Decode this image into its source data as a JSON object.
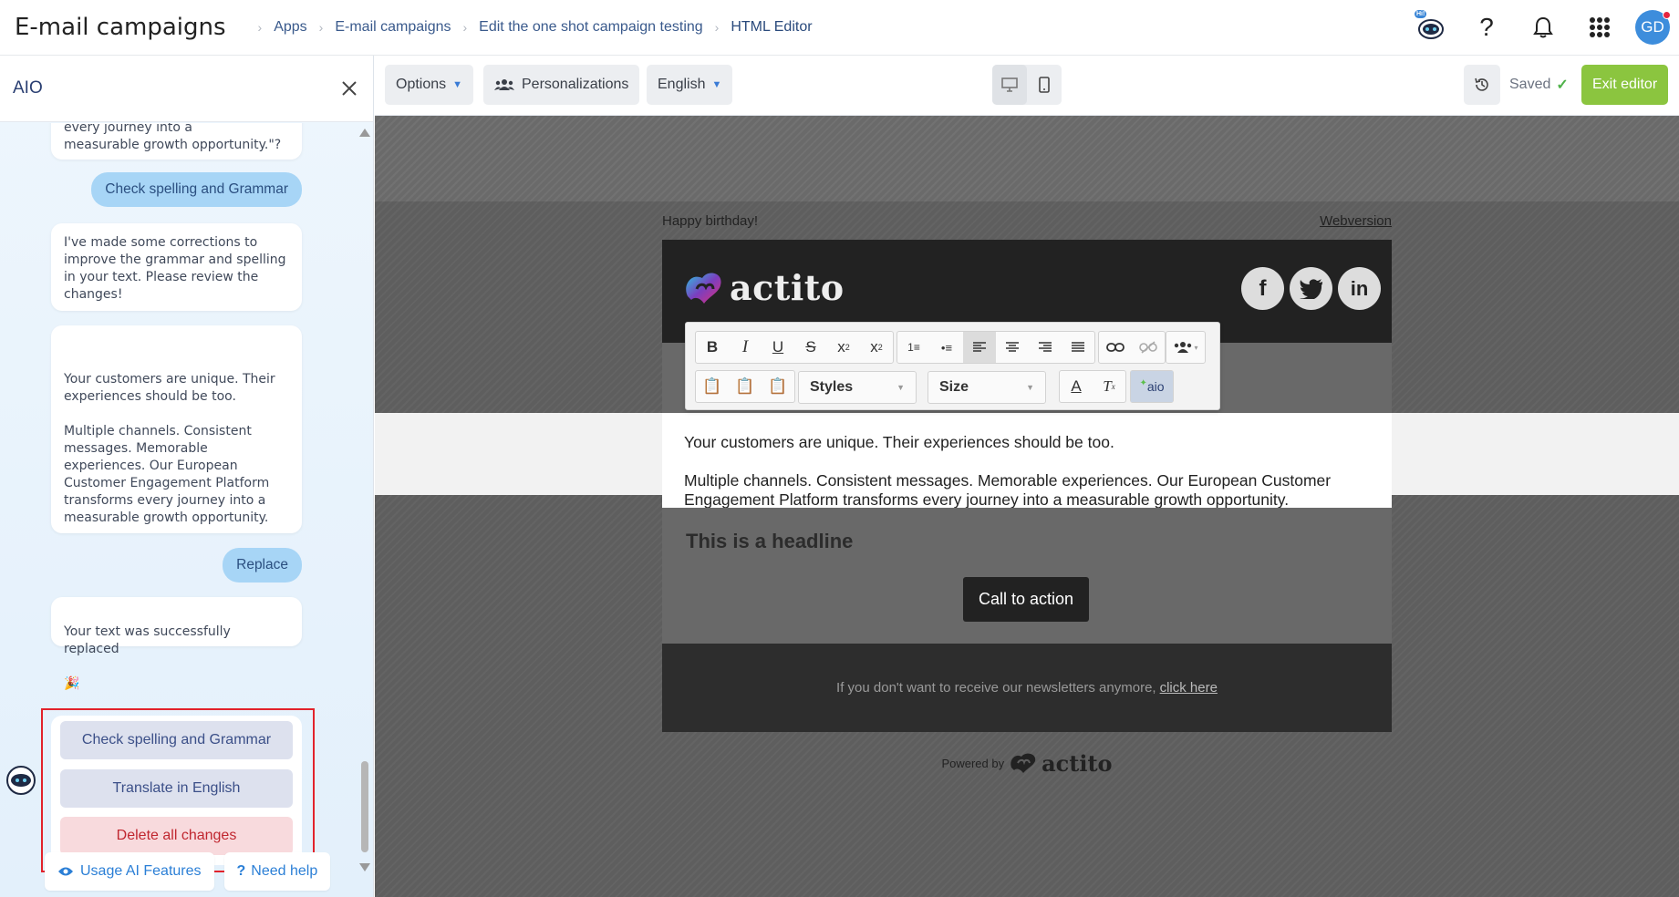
{
  "header": {
    "app_title": "E-mail campaigns",
    "breadcrumb": [
      "Apps",
      "E-mail campaigns",
      "Edit the one shot campaign testing",
      "HTML Editor"
    ],
    "robot_badge": "Hi!",
    "avatar_initials": "GD"
  },
  "aio": {
    "title": "AIO",
    "messages": {
      "top_fragment": "every journey into a\nmeasurable growth opportunity.\"?",
      "user_check": "Check spelling and Grammar",
      "bot_corrections": "I've made some corrections to improve the grammar and spelling in your text. Please review the changes!",
      "bot_result": "Your customers are unique. Their experiences should be too.\n\nMultiple channels. Consistent messages. Memorable experiences. Our European Customer Engagement Platform transforms every journey into a\nmeasurable growth opportunity.",
      "user_replace": "Replace",
      "bot_replaced": "Your text was successfully replaced",
      "bot_replaced_emoji": "🎉"
    },
    "suggestions": [
      "Check spelling and Grammar",
      "Translate in English",
      "Delete all changes"
    ],
    "footer": {
      "usage": "Usage AI Features",
      "help": "Need help"
    }
  },
  "editor": {
    "options_label": "Options",
    "personalizations_label": "Personalizations",
    "language_label": "English",
    "saved_label": "Saved",
    "exit_label": "Exit editor"
  },
  "rte": {
    "styles_label": "Styles",
    "size_label": "Size",
    "aio_label": "aio"
  },
  "email": {
    "preheader": "Happy birthday!",
    "webversion": "Webversion",
    "logo_text": "actito",
    "para1": "Your customers are unique. Their experiences should be too.",
    "para2": "Multiple channels. Consistent messages. Memorable experiences. Our European Customer Engagement Platform transforms every journey into a measurable growth opportunity.",
    "headline": "This is a headline",
    "cta": "Call to action",
    "unsubscribe_text": "If you don't want to receive our newsletters anymore,",
    "unsubscribe_link": "click here",
    "powered_by": "Powered by",
    "powered_logo": "actito"
  },
  "colors": {
    "accent_blue": "#3d8ddc",
    "exit_green": "#8bc53f",
    "highlight_red": "#e2222b"
  }
}
